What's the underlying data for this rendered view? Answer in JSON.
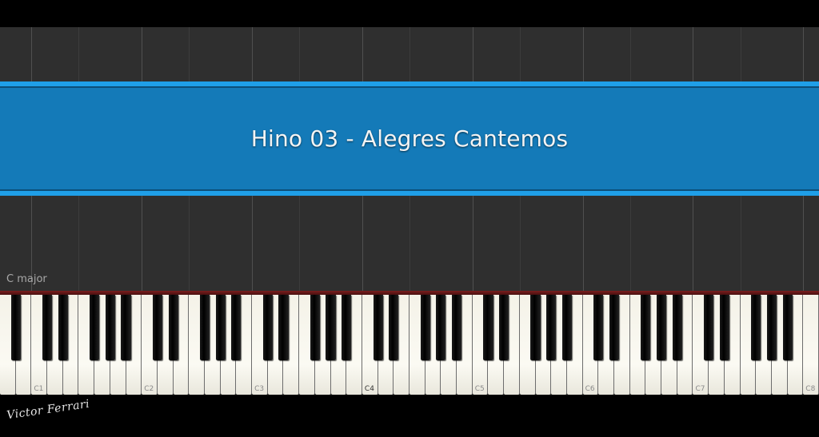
{
  "video": {
    "title": "Hino 03 - Alegres Cantemos",
    "key_signature": "C major",
    "watermark": "Victor Ferrari"
  },
  "keyboard": {
    "octave_labels": [
      "C1",
      "C2",
      "C3",
      "C4",
      "C5",
      "C6",
      "C7",
      "C8"
    ],
    "highlight_label": "C4"
  },
  "colors": {
    "banner": "#147ab8",
    "banner_edge": "#1f9fe8",
    "roll_background": "#2f2f2f"
  }
}
